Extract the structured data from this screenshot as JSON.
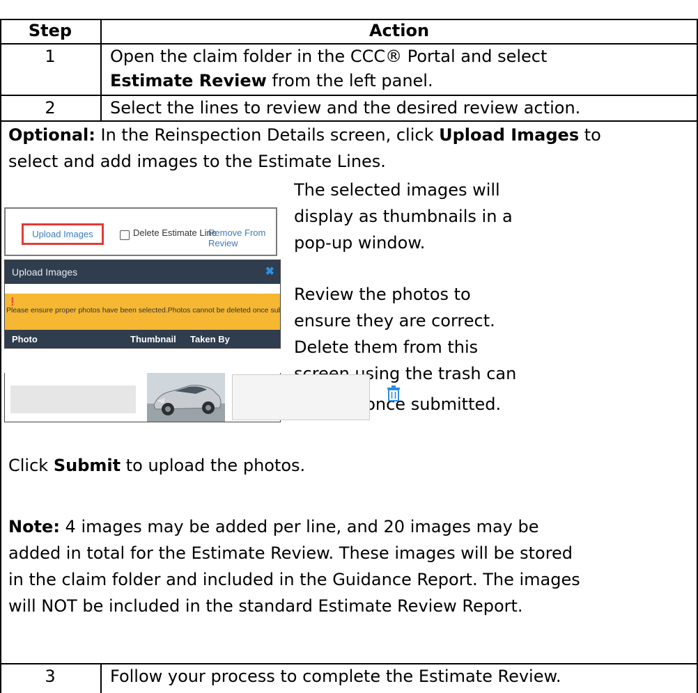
{
  "table": {
    "headers": {
      "step": "Step",
      "action": "Action"
    },
    "rows": [
      {
        "step": "1",
        "line1": "Open the claim folder in the CCC® Portal and select",
        "line2_bold": "Estimate Review",
        "line2_rest": " from the left panel."
      },
      {
        "step": "2",
        "text": "Select the lines to review and the desired review action."
      }
    ],
    "optional": {
      "label": "Optional:",
      "pre": " In the Reinspection Details screen, click ",
      "bold": "Upload Images",
      "post": " to",
      "line2": "select and add images to the Estimate Lines."
    },
    "side_text": {
      "line1": "The selected images will",
      "line2": "display as thumbnails in a",
      "line3": "pop-up window.",
      "line4": "Review the photos to",
      "line5": "ensure they are correct.",
      "line6": "Delete them from this",
      "line7": "screen using the trash can",
      "line8": "icon as needed. Photos cannot be deleted once submitted."
    },
    "submit": {
      "pre": "Click ",
      "bold": "Submit",
      "post": " to upload the photos."
    },
    "note": {
      "label": "Note:",
      "line1": " 4 images may be added per line, and 20 images may be",
      "line2": "added in total for the Estimate Review. These images will be stored",
      "line3": "in the claim folder and included in the Guidance Report. The images",
      "line4": "will NOT be included in the standard Estimate Review Report."
    },
    "row3": {
      "step": "3",
      "text": "Follow your process to complete the Estimate Review."
    }
  },
  "screenshot": {
    "upload_button": "Upload Images",
    "delete_checkbox_label": "Delete Estimate Line",
    "remove_link": "Remove From Review",
    "modal_title": "Upload Images",
    "close_glyph": "✖",
    "warning_icon": "❗",
    "warning_text": "Please ensure proper photos have been selected.Photos cannot be deleted once submitted.",
    "columns": {
      "photo": "Photo",
      "thumbnail": "Thumbnail",
      "taken_by": "Taken By"
    },
    "icons": {
      "trash": "trash-icon",
      "close": "close-icon",
      "warning": "exclamation-icon"
    }
  }
}
